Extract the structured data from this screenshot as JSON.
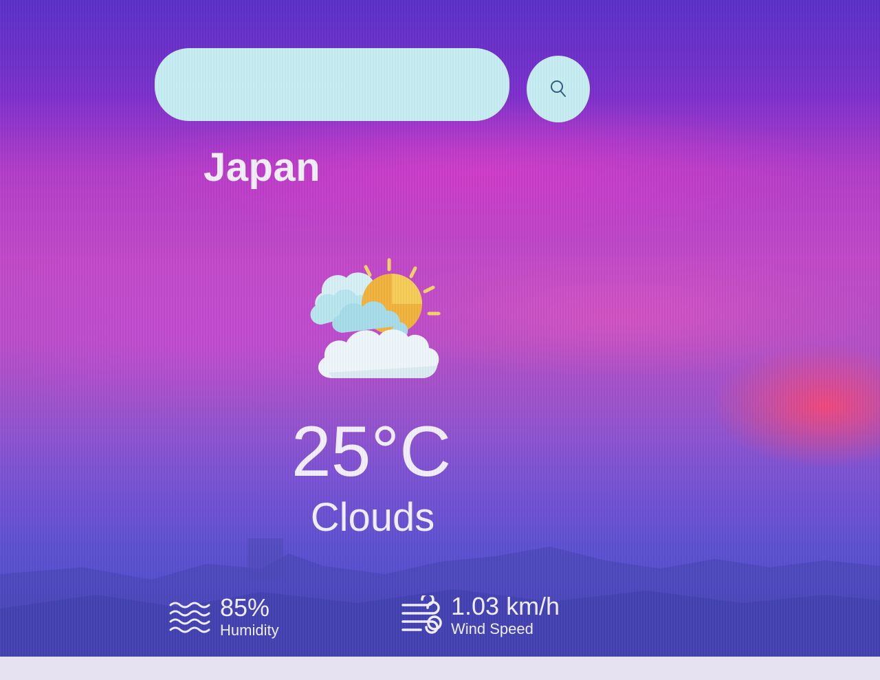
{
  "search": {
    "value": "",
    "placeholder": "",
    "button_icon": "search-icon"
  },
  "weather": {
    "city": "Japan",
    "temperature": "25°C",
    "condition": "Clouds",
    "condition_icon": "partly-cloudy-icon"
  },
  "details": {
    "humidity": {
      "value": "85%",
      "label": "Humidity",
      "icon": "humidity-waves-icon"
    },
    "wind": {
      "value": "1.03 km/h",
      "label": "Wind Speed",
      "icon": "wind-icon"
    }
  },
  "colors": {
    "text": "#f3f0fb",
    "input_background": "#c6eef3",
    "sky_top": "#5a2fc8",
    "sky_middle": "#c248c8",
    "sky_bottom": "#4a4bc7"
  }
}
